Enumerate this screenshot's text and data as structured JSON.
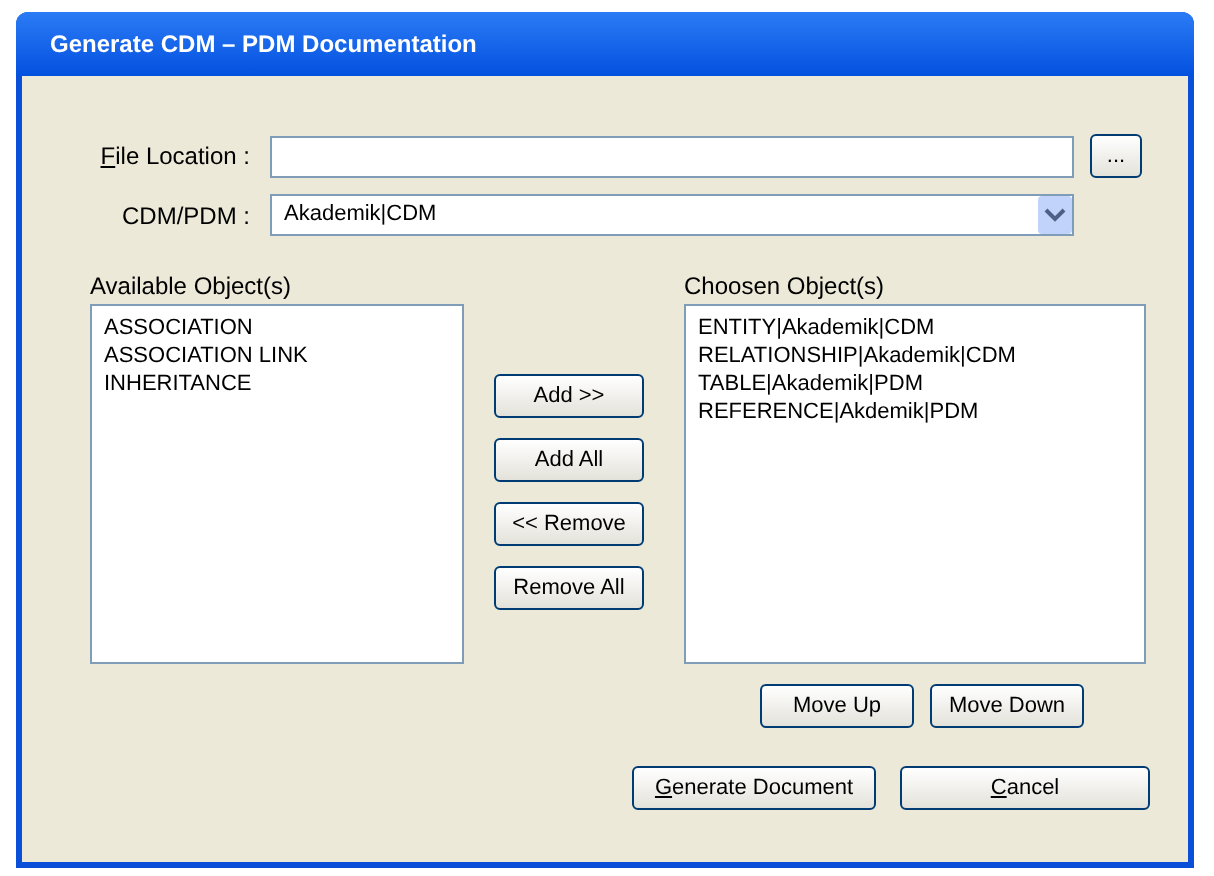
{
  "window": {
    "title": "Generate CDM – PDM Documentation"
  },
  "file_location": {
    "label": "File Location :",
    "underline_first": true,
    "browse_button": "..."
  },
  "cdm_pdm": {
    "label": "CDM/PDM :",
    "value": "Akademik|CDM"
  },
  "available": {
    "label": "Available Object(s)",
    "items": [
      "ASSOCIATION",
      "ASSOCIATION LINK",
      "INHERITANCE"
    ]
  },
  "transfer_buttons": [
    "Add >>",
    "Add All",
    "<< Remove",
    "Remove All"
  ],
  "chosen": {
    "label": "Choosen Object(s)",
    "items": [
      "ENTITY|Akademik|CDM",
      "RELATIONSHIP|Akademik|CDM",
      "TABLE|Akademik|PDM",
      "REFERENCE|Akdemik|PDM"
    ]
  },
  "order_buttons": [
    "Move Up",
    "Move Down"
  ],
  "actions": [
    {
      "label": "Generate Document",
      "underline_first": true
    },
    {
      "label": "Cancel",
      "underline_first": true
    }
  ]
}
